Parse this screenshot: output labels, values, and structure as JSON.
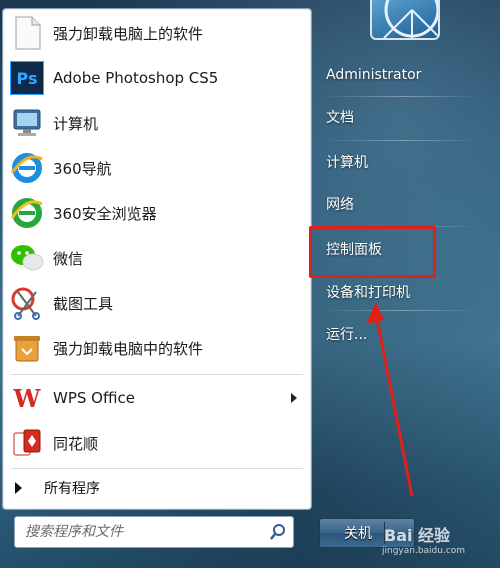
{
  "programs": [
    {
      "label": "强力卸载电脑上的软件",
      "icon": "blank-document-icon"
    },
    {
      "label": "Adobe Photoshop CS5",
      "icon": "photoshop-icon",
      "icon_text": "Ps"
    },
    {
      "label": "计算机",
      "icon": "computer-icon"
    },
    {
      "label": "360导航",
      "icon": "internet-explorer-icon"
    },
    {
      "label": "360安全浏览器",
      "icon": "browser-icon"
    },
    {
      "label": "微信",
      "icon": "wechat-icon"
    },
    {
      "label": "截图工具",
      "icon": "snipping-tool-icon"
    },
    {
      "label": "强力卸载电脑中的软件",
      "icon": "uninstaller-icon"
    }
  ],
  "pinned": [
    {
      "label": "WPS Office",
      "icon": "wps-icon",
      "icon_text": "W"
    },
    {
      "label": "同花顺",
      "icon": "tonghuashun-icon"
    }
  ],
  "all_programs_label": "所有程序",
  "search": {
    "placeholder": "搜索程序和文件"
  },
  "right_links": [
    {
      "label": "Administrator"
    },
    {
      "label": "文档"
    },
    {
      "label": "计算机"
    },
    {
      "label": "网络"
    },
    {
      "label": "控制面板"
    },
    {
      "label": "设备和打印机"
    },
    {
      "label": "运行..."
    }
  ],
  "shutdown_label": "关机",
  "watermark": {
    "main": "Bai 经验",
    "sub": "jingyan.baidu.com"
  },
  "colors": {
    "highlight": "#e0211b",
    "photoshop_bg": "#0d2a4a",
    "photoshop_text": "#31a8ff",
    "wps_red": "#d42a22"
  }
}
